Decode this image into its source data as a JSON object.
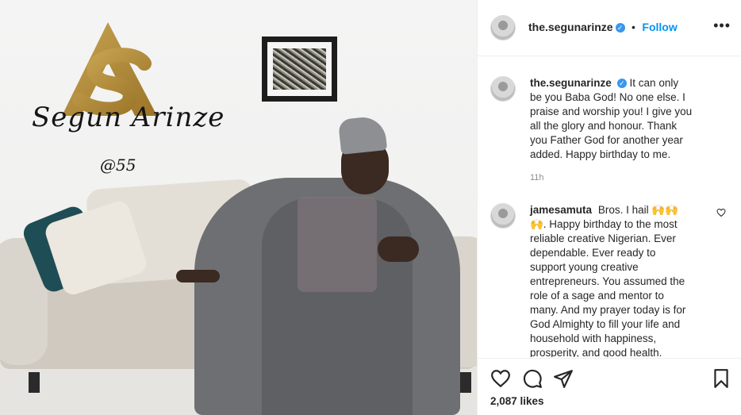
{
  "post": {
    "photo": {
      "logo_text": "AS",
      "signature": "Segun Arinze",
      "age_text": "@55"
    },
    "header": {
      "username": "the.segunarinze",
      "separator": "•",
      "follow_label": "Follow",
      "more_label": "•••"
    },
    "caption": {
      "username": "the.segunarinze",
      "text": "It can only be you Baba God! No one else. I praise and worship you! I give you all the glory and honour. Thank you Father God for another year added. Happy birthday to me.",
      "time": "11h"
    },
    "comment": {
      "username": "jamesamuta",
      "text": "Bros. I hail 🙌🙌🙌. Happy birthday to the most reliable creative Nigerian. Ever dependable. Ever ready to support young creative entrepreneurs. You assumed the role of a sage and mentor to many. And my prayer today is for God Almighty to fill your life and household with happiness, prosperity, and good health."
    },
    "likes": "2,087 likes",
    "icons": {
      "like": "heart-icon",
      "comment": "comment-bubble-icon",
      "share": "paper-plane-icon",
      "save": "bookmark-icon",
      "verified": "verified-badge-icon",
      "more": "more-options-icon"
    },
    "colors": {
      "accent": "#0095f6",
      "verified": "#3897f0",
      "logo_gold": "#b8913c"
    }
  }
}
